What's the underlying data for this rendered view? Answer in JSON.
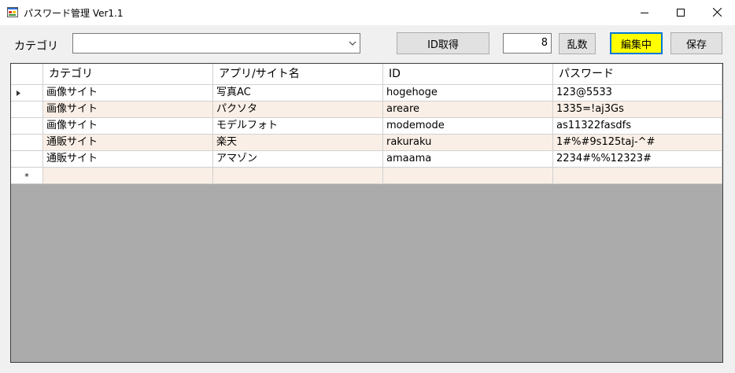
{
  "window": {
    "title": "パスワード管理 Ver1.1",
    "controls": {
      "minimize": "minimize-icon",
      "maximize": "maximize-icon",
      "close": "close-icon"
    }
  },
  "toolbar": {
    "category_label": "カテゴリ",
    "category_combo_value": "",
    "id_button_label": "ID取得",
    "length_value": "8",
    "random_button_label": "乱数",
    "edit_button_label": "編集中",
    "save_button_label": "保存"
  },
  "colors": {
    "edit_button_bg": "#ffff00",
    "edit_button_border": "#0078d7",
    "grid_bg": "#ababab",
    "alt_row_bg": "#faefe6"
  },
  "grid": {
    "columns": [
      "カテゴリ",
      "アプリ/サイト名",
      "ID",
      "パスワード"
    ],
    "rows": [
      {
        "marker": "▶",
        "cells": [
          "画像サイト",
          "写真AC",
          "hogehoge",
          "123@5533"
        ]
      },
      {
        "marker": "",
        "cells": [
          "画像サイト",
          "パクソタ",
          "areare",
          "1335=!aj3Gs"
        ]
      },
      {
        "marker": "",
        "cells": [
          "画像サイト",
          "モデルフォト",
          "modemode",
          "as11322fasdfs"
        ]
      },
      {
        "marker": "",
        "cells": [
          "通販サイト",
          "楽天",
          "rakuraku",
          "1#%#9s125taj-^#"
        ]
      },
      {
        "marker": "",
        "cells": [
          "通販サイト",
          "アマゾン",
          "amaama",
          "2234#%%12323#"
        ]
      }
    ],
    "new_row_marker": "*"
  }
}
